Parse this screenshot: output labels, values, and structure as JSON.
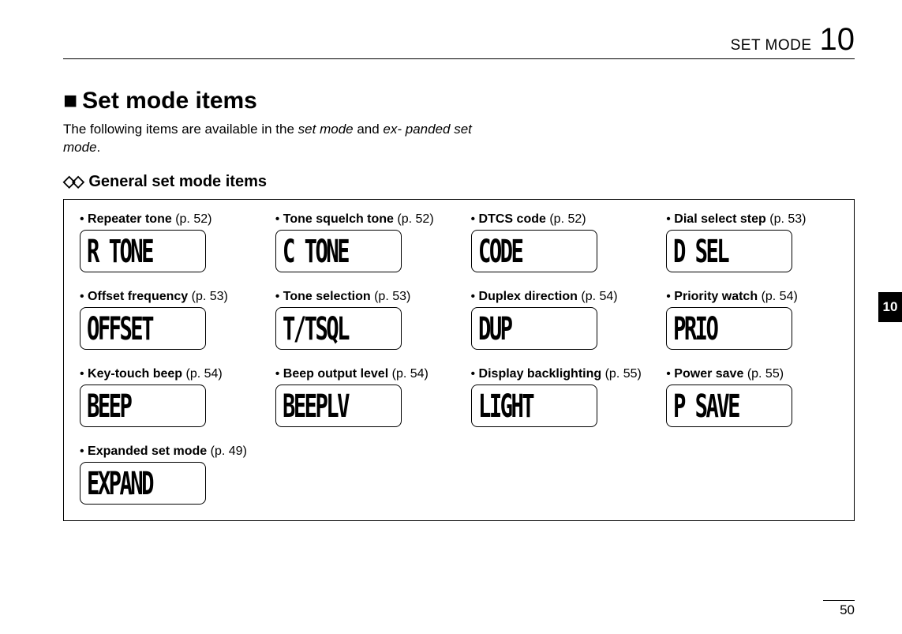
{
  "header": {
    "label": "SET MODE",
    "chapter": "10"
  },
  "sideTab": "10",
  "pageNumber": "50",
  "section": {
    "bullet": "■",
    "title": "Set mode items",
    "introPre": "The following items are available in the ",
    "introItal1": "set mode",
    "introMid": " and ",
    "introItal2": "ex-\npanded set mode",
    "introPost": "."
  },
  "sub": {
    "diamond": "◇◇",
    "title": "General set mode items"
  },
  "items": [
    {
      "label": "Repeater tone",
      "page": "(p. 52)",
      "lcd": "R TONE"
    },
    {
      "label": "Tone squelch tone",
      "page": "(p. 52)",
      "lcd": "C TONE"
    },
    {
      "label": "DTCS code",
      "page": "(p. 52)",
      "lcd": "CODE"
    },
    {
      "label": "Dial select step",
      "page": "(p. 53)",
      "lcd": "D SEL"
    },
    {
      "label": "Offset frequency",
      "page": "(p. 53)",
      "lcd": "OFFSET"
    },
    {
      "label": "Tone selection",
      "page": "(p. 53)",
      "lcd": "T/TSQL"
    },
    {
      "label": "Duplex direction",
      "page": "(p. 54)",
      "lcd": "DUP"
    },
    {
      "label": "Priority watch",
      "page": "(p. 54)",
      "lcd": "PRIO"
    },
    {
      "label": "Key-touch beep",
      "page": "(p. 54)",
      "lcd": "BEEP"
    },
    {
      "label": "Beep output level",
      "page": "(p. 54)",
      "lcd": "BEEPLV"
    },
    {
      "label": "Display backlighting",
      "page": "(p. 55)",
      "lcd": "LIGHT"
    },
    {
      "label": "Power save",
      "page": "(p. 55)",
      "lcd": "P SAVE"
    },
    {
      "label": "Expanded set mode",
      "page": "(p. 49)",
      "lcd": "EXPAND"
    }
  ]
}
